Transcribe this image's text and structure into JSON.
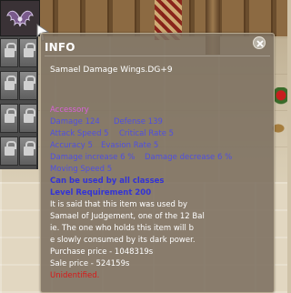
{
  "inventory": {
    "locked_slots": 8
  },
  "info_window": {
    "title": "INFO",
    "item_name": "Samael Damage Wings.DG+9",
    "category": "Accessory",
    "stats": [
      {
        "left": "Damage 124",
        "right": "Defense 139"
      },
      {
        "left": "Attack Speed 5",
        "right": "Critical Rate 5"
      },
      {
        "left": "Accuracy 5",
        "right": "Evasion Rate 5"
      },
      {
        "left": "Damage increase 6 %",
        "right": "Damage decrease 6 %"
      },
      {
        "left": "Moving Speed 5",
        "right": ""
      }
    ],
    "class_requirement": "Can be used by all classes",
    "level_requirement": "Level Requirement 200",
    "description": [
      "It is said that this item was used by",
      "Samael of Judgement, one of the 12 Bal",
      "ie. The one who holds this item will b",
      "e slowly consumed by its dark power."
    ],
    "purchase_price": "Purchase price - 1048319s",
    "sale_price": "Sale price - 524159s",
    "status": "Unidentified."
  },
  "colors": {
    "category": "#d862d8",
    "option_blue": "#4f4fe0",
    "requirement_blue": "#3333d6",
    "description_white": "#ffffff",
    "status_red": "#d81818",
    "panel_bg": "#7c7060"
  },
  "icons": [
    "wings-icon",
    "lock-icon",
    "close-icon",
    "cursor-icon"
  ]
}
